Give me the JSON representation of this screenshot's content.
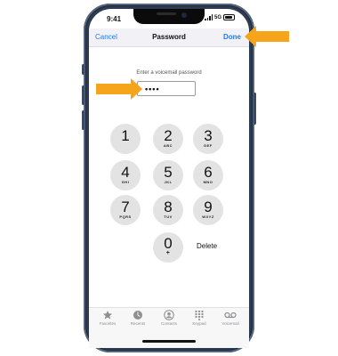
{
  "status": {
    "time": "9:41",
    "network": "5G"
  },
  "nav": {
    "cancel": "Cancel",
    "title": "Password",
    "done": "Done"
  },
  "form": {
    "prompt": "Enter a voicemail password",
    "value": "••••"
  },
  "keypad": {
    "keys": [
      {
        "num": "1",
        "letters": ""
      },
      {
        "num": "2",
        "letters": "ABC"
      },
      {
        "num": "3",
        "letters": "DEF"
      },
      {
        "num": "4",
        "letters": "GHI"
      },
      {
        "num": "5",
        "letters": "JKL"
      },
      {
        "num": "6",
        "letters": "MNO"
      },
      {
        "num": "7",
        "letters": "PQRS"
      },
      {
        "num": "8",
        "letters": "TUV"
      },
      {
        "num": "9",
        "letters": "WXYZ"
      },
      {
        "num": "0",
        "letters": "+"
      }
    ],
    "delete": "Delete"
  },
  "tabs": [
    {
      "label": "Favorites",
      "icon": "star-icon"
    },
    {
      "label": "Recents",
      "icon": "clock-icon"
    },
    {
      "label": "Contacts",
      "icon": "contacts-icon"
    },
    {
      "label": "Keypad",
      "icon": "keypad-icon"
    },
    {
      "label": "Voicemail",
      "icon": "voicemail-icon"
    }
  ],
  "colors": {
    "accent": "#1e7cf2",
    "arrow": "#f5a41c",
    "key_bg": "#e3e3e3"
  }
}
